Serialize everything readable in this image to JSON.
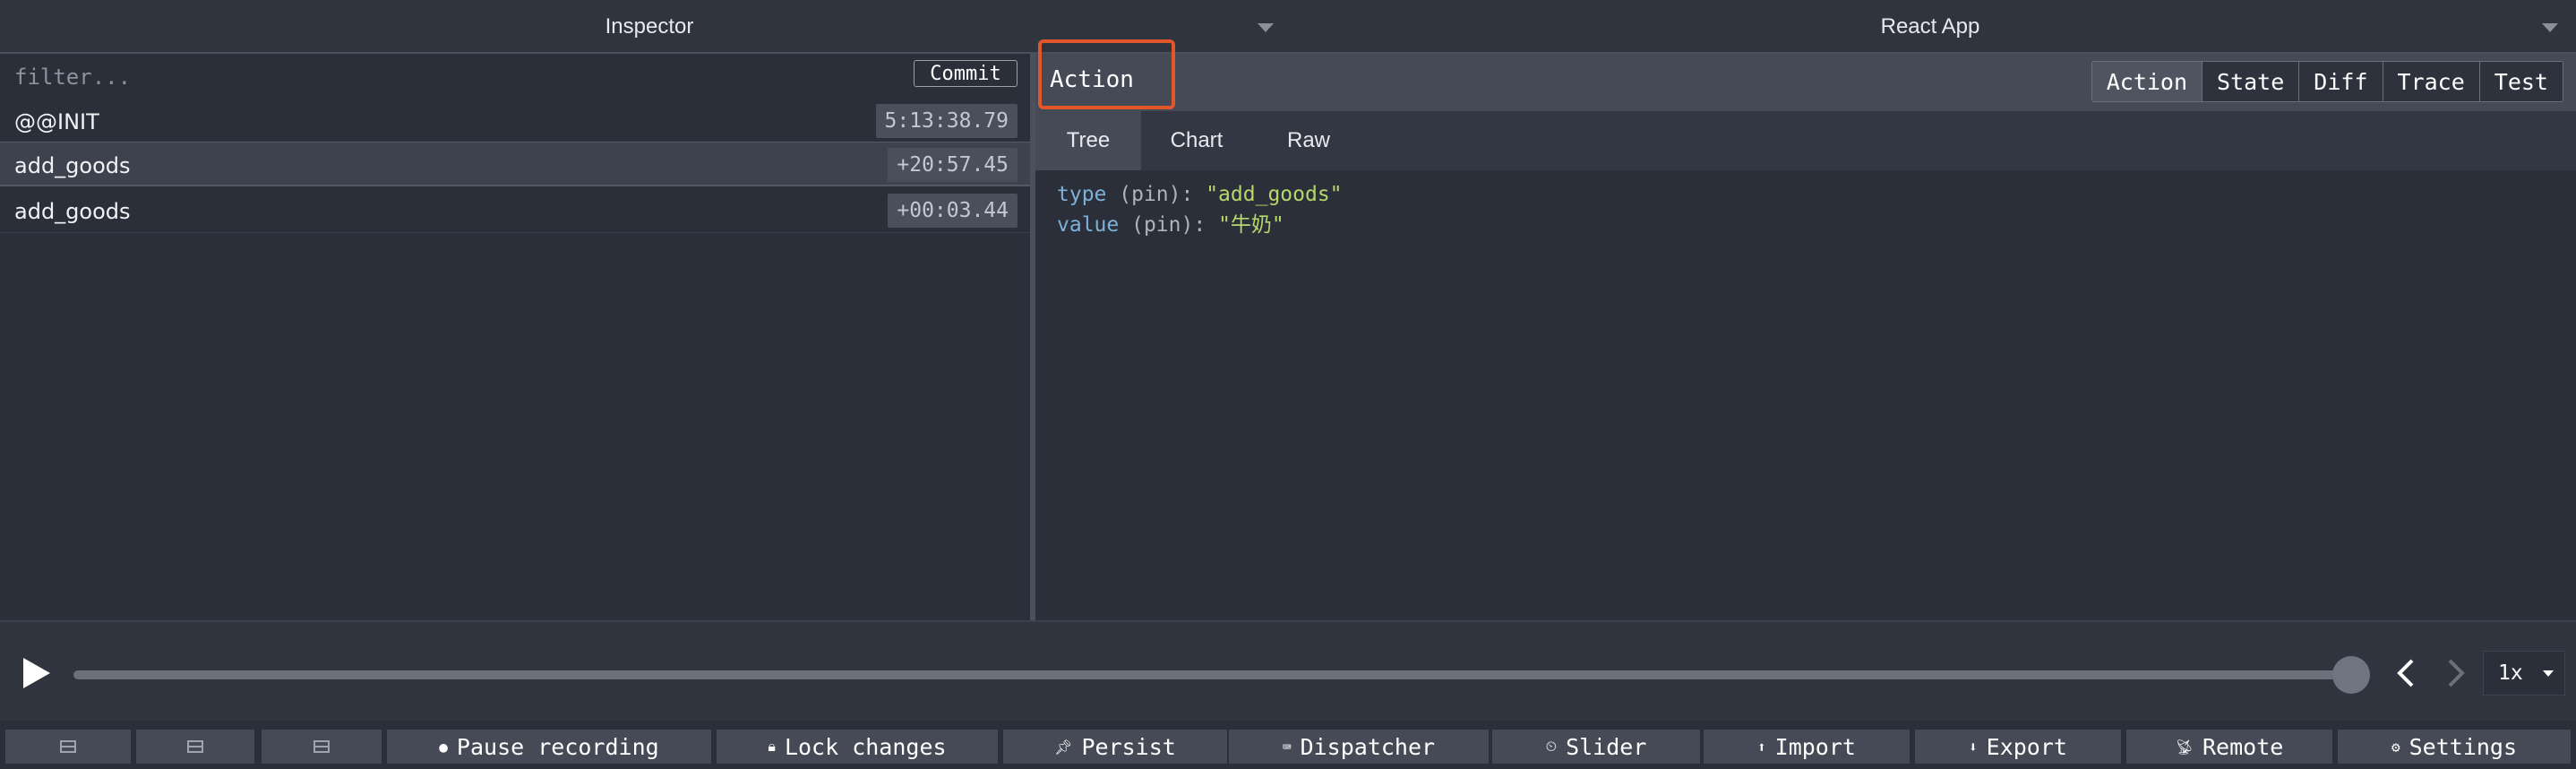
{
  "header": {
    "left_title": "Inspector",
    "right_title": "React App"
  },
  "filter": {
    "placeholder": "filter...",
    "commit_label": "Commit"
  },
  "actions": [
    {
      "name": "@@INIT",
      "time": "5:13:38.79"
    },
    {
      "name": "add_goods",
      "time": "+20:57.45"
    },
    {
      "name": "add_goods",
      "time": "+00:03.44"
    }
  ],
  "detail": {
    "title": "Action",
    "tabs": [
      "Action",
      "State",
      "Diff",
      "Trace",
      "Test"
    ],
    "active_tab": "Action",
    "subtabs": [
      "Tree",
      "Chart",
      "Raw"
    ],
    "active_subtab": "Tree",
    "tree": [
      {
        "key": "type",
        "pin": "(pin)",
        "value": "\"add_goods\""
      },
      {
        "key": "value",
        "pin": "(pin)",
        "value": "\"牛奶\""
      }
    ]
  },
  "slider": {
    "speed": "1x",
    "position_fraction": 1.0
  },
  "toolbar": {
    "pause_label": "Pause recording",
    "lock_label": "Lock changes",
    "persist_label": "Persist",
    "dispatcher_label": "Dispatcher",
    "slider_label": "Slider",
    "import_label": "Import",
    "export_label": "Export",
    "remote_label": "Remote",
    "settings_label": "Settings"
  },
  "colors": {
    "background": "#2a2f3a",
    "highlight_box": "#e2562a",
    "tree_key": "#7fb0d8",
    "tree_string": "#b6d86a"
  }
}
